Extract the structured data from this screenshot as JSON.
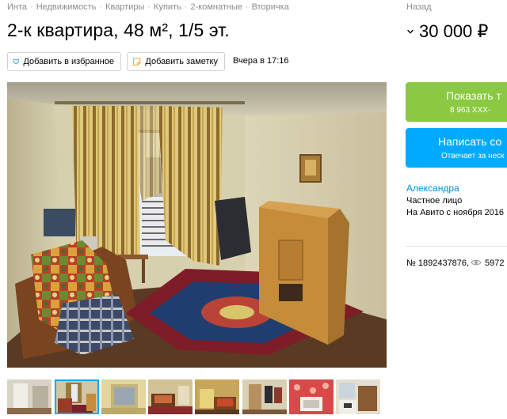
{
  "breadcrumbs": [
    "Инта",
    "Недвижимость",
    "Квартиры",
    "Купить",
    "2-комнатные",
    "Вторичка"
  ],
  "back_label": "Назад",
  "title": "2-к квартира, 48 м², 1/5 эт.",
  "price": "30 000 ₽",
  "favorites_label": "Добавить в избранное",
  "note_label": "Добавить заметку",
  "posted_date": "Вчера в 17:16",
  "contact": {
    "show_phone_label": "Показать т",
    "phone_masked": "8 963 XXX-",
    "write_label": "Написать со",
    "write_sub": "Отвечает за неск"
  },
  "seller": {
    "name": "Александра",
    "type": "Частное лицо",
    "since": "На Авито с ноября 2016"
  },
  "ad_number": "№ 1892437876,",
  "views": "5972 (",
  "thumbnails": [
    {
      "name": "hallway",
      "active": false
    },
    {
      "name": "room-window",
      "active": true
    },
    {
      "name": "window-view",
      "active": false
    },
    {
      "name": "bedroom",
      "active": false
    },
    {
      "name": "bedroom-2",
      "active": false
    },
    {
      "name": "entry-clothes",
      "active": false
    },
    {
      "name": "red-wallpaper",
      "active": false
    },
    {
      "name": "kitchen",
      "active": false
    }
  ],
  "colors": {
    "green_button": "#8ac941",
    "blue_button": "#00aaff",
    "link": "#0091d9",
    "active_thumb_outline": "#00aaff"
  }
}
